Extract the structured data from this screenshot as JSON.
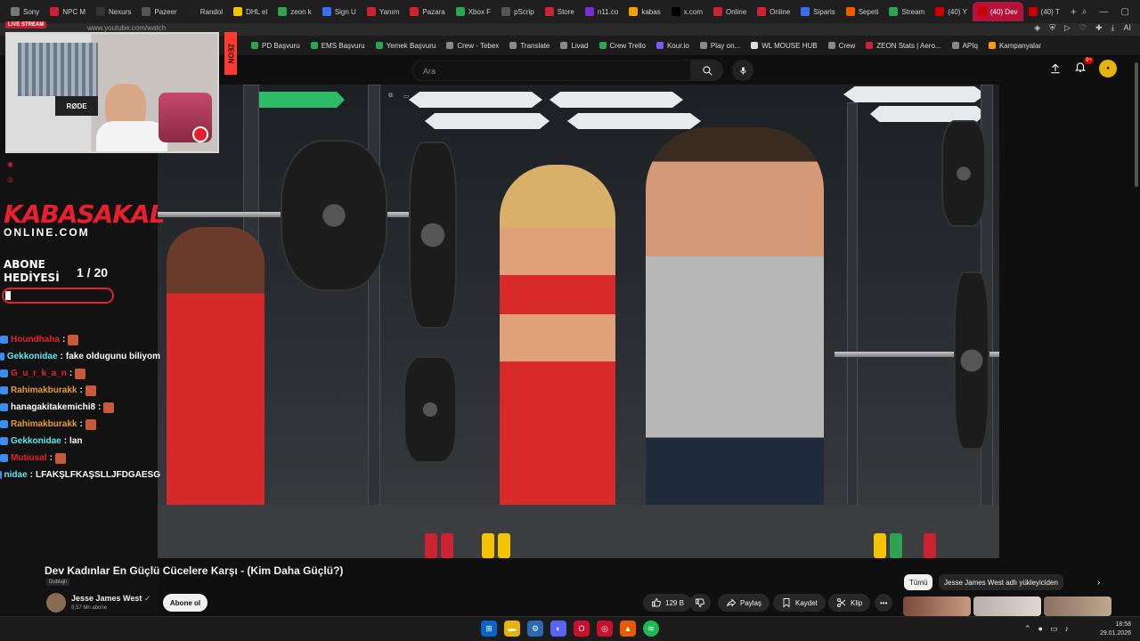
{
  "browser": {
    "tabs": [
      {
        "label": "Sony",
        "color": "#777777"
      },
      {
        "label": "NPC M",
        "color": "#cc2233"
      },
      {
        "label": "Nexurs",
        "color": "#333333"
      },
      {
        "label": "Pazeer",
        "color": "#555555"
      },
      {
        "label": "Randol",
        "color": "#222222"
      },
      {
        "label": "DHL el",
        "color": "#f5c400"
      },
      {
        "label": "zeon k",
        "color": "#2ea44f"
      },
      {
        "label": "Sign U",
        "color": "#3b6ef0"
      },
      {
        "label": "Yanım",
        "color": "#cc2233"
      },
      {
        "label": "Pazara",
        "color": "#cc2233"
      },
      {
        "label": "Xbox F",
        "color": "#2ea44f"
      },
      {
        "label": "pScrip",
        "color": "#555555"
      },
      {
        "label": "Store",
        "color": "#cc2233"
      },
      {
        "label": "n11.co",
        "color": "#7a2ecc"
      },
      {
        "label": "kabas",
        "color": "#f5a000"
      },
      {
        "label": "x.com",
        "color": "#000000"
      },
      {
        "label": "Online",
        "color": "#cc2233"
      },
      {
        "label": "Online",
        "color": "#cc2233"
      },
      {
        "label": "Siparis",
        "color": "#3b6ef0"
      },
      {
        "label": "Sepeti",
        "color": "#f55a00"
      },
      {
        "label": "Stream",
        "color": "#2ea44f"
      },
      {
        "label": "(40) Y",
        "color": "#cc0000"
      },
      {
        "label": "(40) Dev",
        "color": "#cc0000",
        "active": true
      },
      {
        "label": "(40) T",
        "color": "#cc0000"
      }
    ],
    "url": "www.youtube.com/watch",
    "bookmarks": [
      {
        "label": "PD Başvuru",
        "color": "#2ea44f"
      },
      {
        "label": "EMS Başvuru",
        "color": "#2ea44f"
      },
      {
        "label": "Yemek Başvuru",
        "color": "#2ea44f"
      },
      {
        "label": "Crew - Tebex",
        "color": "#888888"
      },
      {
        "label": "Translate",
        "color": "#888888"
      },
      {
        "label": "Livad",
        "color": "#888888"
      },
      {
        "label": "Crew Trello",
        "color": "#2ea44f"
      },
      {
        "label": "Kour.io",
        "color": "#7a5af8"
      },
      {
        "label": "Play on...",
        "color": "#888888"
      },
      {
        "label": "WL MOUSE HUB",
        "color": "#dddddd"
      },
      {
        "label": "Crew",
        "color": "#888888"
      },
      {
        "label": "ZEON Stats | Aero...",
        "color": "#cc2233"
      },
      {
        "label": "APIq",
        "color": "#888888"
      },
      {
        "label": "Kampanyalar",
        "color": "#f5a000"
      }
    ]
  },
  "youtube": {
    "search_placeholder": "Ara",
    "notif_count": "9+",
    "video": {
      "title": "Dev Kadınlar En Güçlü Cücelere Karşı - (Kim Daha Güçlü?)",
      "dub_label": "Dublajlı",
      "channel": "Jesse James West",
      "subscribers": "8,57 Mn abone",
      "subscribe_label": "Abone ol",
      "likes": "129 B",
      "share_label": "Paylaş",
      "save_label": "Kaydet",
      "clip_label": "Klip"
    },
    "chips": {
      "all": "Tümü",
      "channel": "Jesse James West adlı yükleyiciden"
    }
  },
  "stream_overlay": {
    "live_label": "LIVE STREAM",
    "side_label": "ZEON",
    "brand_top": "KABASAKAL",
    "brand_bottom": "ONLINE.COM",
    "gift_line1": "ABONE",
    "gift_line2": "HEDİYESİ",
    "gift_count": "1 / 20",
    "gift_progress": 0.05,
    "chat": [
      {
        "user": "Houndhaha",
        "user_color": "red",
        "message": ""
      },
      {
        "user": "Gekkonidae",
        "user_color": "cyan",
        "message": "fake oldugunu biliyom"
      },
      {
        "user": "G_u_r_k_a_n",
        "user_color": "red",
        "message": ""
      },
      {
        "user": "Rahimakburakk",
        "user_color": "orange",
        "message": ""
      },
      {
        "user": "hanagakitakemichi8",
        "user_color": "white",
        "message": ""
      },
      {
        "user": "Rahimakburakk",
        "user_color": "orange",
        "message": ""
      },
      {
        "user": "Gekkonidae",
        "user_color": "cyan",
        "message": "lan"
      },
      {
        "user": "Mutiusal",
        "user_color": "red",
        "message": ""
      },
      {
        "user": "nidae",
        "user_color": "cyan",
        "message": "LFAKŞLFKAŞSLLJFDGAESG"
      }
    ]
  },
  "taskbar": {
    "time": "18:58",
    "date": "29.01.2026"
  },
  "colors": {
    "accent": "#e8202e",
    "bg": "#0f0f0f"
  }
}
